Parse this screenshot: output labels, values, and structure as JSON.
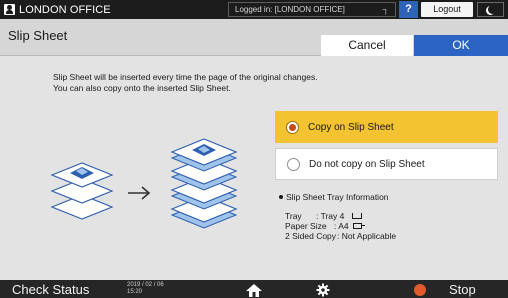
{
  "topbar": {
    "user_name": "LONDON OFFICE",
    "login_status": "Logged in: [LONDON OFFICE]",
    "help_label": "?",
    "logout_label": "Logout"
  },
  "header": {
    "title": "Slip Sheet",
    "cancel_label": "Cancel",
    "ok_label": "OK"
  },
  "main": {
    "intro_line1": "Slip Sheet will be inserted every time the page of the original changes.",
    "intro_line2": "You can also copy onto the inserted Slip Sheet.",
    "options": [
      {
        "label": "Copy on Slip Sheet",
        "selected": true
      },
      {
        "label": "Do not copy on Slip Sheet",
        "selected": false
      }
    ],
    "tray_info": {
      "heading": "Slip Sheet Tray Information",
      "tray_label": "Tray",
      "tray_value": ": Tray 4",
      "paper_size_label": "Paper Size",
      "paper_size_value": ": A4",
      "sided_label": "2 Sided Copy",
      "sided_value": ": Not Applicable"
    }
  },
  "bottombar": {
    "check_status_label": "Check Status",
    "date": "2019 / 02 / 06",
    "time": "15:20",
    "stop_label": "Stop"
  },
  "colors": {
    "selected_option": "#f3c332",
    "ok_button": "#2b64c2",
    "help_button": "#2e63b8",
    "stop_icon": "#e25b2d",
    "sheet_blue": "#2d5fb0",
    "sheet_light_blue": "#9fc3ea"
  },
  "icons": {
    "user": "user-icon",
    "home": "home-icon",
    "settings": "gear-icon",
    "stop": "stop-icon",
    "moon": "moon-icon",
    "tray": "tray-icon",
    "paper": "paper-orientation-icon"
  }
}
